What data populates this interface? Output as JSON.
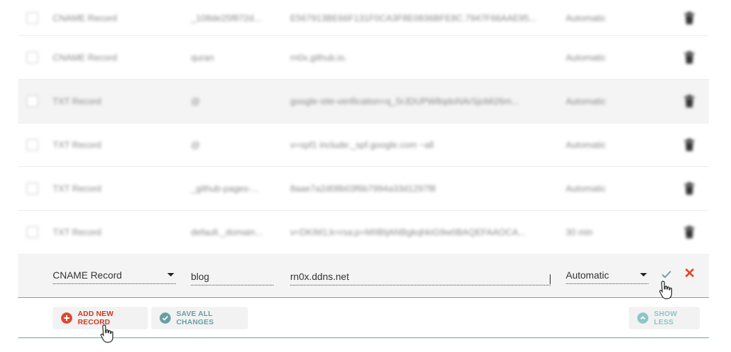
{
  "records": [
    {
      "type": "CNAME Record",
      "host": "_108de25f872d...",
      "value": "E567913BE66F131F0CA3F8E0836BFE8C.7947F66AAE95...",
      "ttl": "Automatic"
    },
    {
      "type": "CNAME Record",
      "host": "quran",
      "value": "rn0x.github.io.",
      "ttl": "Automatic"
    },
    {
      "type": "TXT Record",
      "host": "@",
      "value": "google-site-verification=q_5rJDUPW8qdoNArSjoMi26m...",
      "ttl": "Automatic"
    },
    {
      "type": "TXT Record",
      "host": "@",
      "value": "v=spf1 include:_spf.google.com ~all",
      "ttl": "Automatic"
    },
    {
      "type": "TXT Record",
      "host": "_github-pages-...",
      "value": "8aae7a2d08b03f6b7994a33d1297f8",
      "ttl": "Automatic"
    },
    {
      "type": "TXT Record",
      "host": "default._domain...",
      "value": "v=DKIM1;k=rsa;p=MIIBIjANBgkqhkiG9w0BAQEFAAOCA...",
      "ttl": "30 min"
    }
  ],
  "new_record": {
    "type": "CNAME Record",
    "host": "blog",
    "value": "rn0x.ddns.net",
    "ttl": "Automatic"
  },
  "actions": {
    "add_label": "ADD NEW RECORD",
    "save_label": "SAVE ALL CHANGES",
    "less_label": "SHOW LESS"
  },
  "icons": {
    "delete": "trash-icon",
    "confirm": "checkmark-icon",
    "cancel": "close-icon",
    "add": "plus-circle-icon",
    "save": "check-circle-icon",
    "less": "chevron-up-circle-icon",
    "pointer": "hand-pointer-icon"
  },
  "colors": {
    "accent_red": "#e2462b",
    "accent_teal": "#6a9fa1",
    "accent_teal_light": "#8ec5c7",
    "row_alt": "#f4f4f4"
  }
}
